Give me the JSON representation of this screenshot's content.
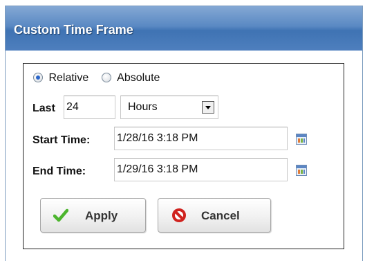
{
  "dialog": {
    "title": "Custom Time Frame"
  },
  "mode": {
    "relative_label": "Relative",
    "absolute_label": "Absolute",
    "selected": "Relative"
  },
  "last": {
    "label": "Last",
    "value": "24",
    "unit_selected": "Hours"
  },
  "start": {
    "label": "Start Time:",
    "value": "1/28/16 3:18 PM"
  },
  "end": {
    "label": "End Time:",
    "value": "1/29/16 3:18 PM"
  },
  "buttons": {
    "apply": "Apply",
    "cancel": "Cancel"
  },
  "icons": {
    "apply": "checkmark-icon",
    "cancel": "no-entry-icon",
    "date_picker": "calendar-icon"
  },
  "colors": {
    "title_bar": "#4e7fbe",
    "check": "#4cb52e",
    "cancel": "#d0231f"
  }
}
